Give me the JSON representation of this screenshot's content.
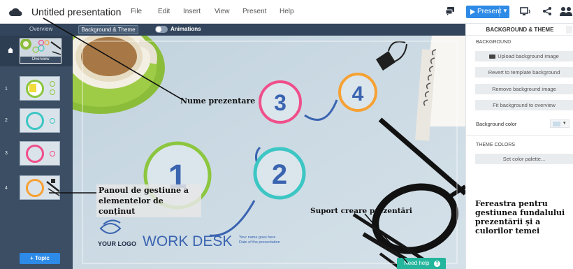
{
  "window": {
    "title": "Untitled presentation",
    "menu": [
      "File",
      "Edit",
      "Insert",
      "View",
      "Present",
      "Help"
    ],
    "present_label": "Present"
  },
  "subbar": {
    "overview": "Overview",
    "background_theme": "Background & Theme",
    "animations": "Animations"
  },
  "left_panel": {
    "overview_label": "Overview",
    "slides": [
      {
        "number": "1",
        "ring_color": "#8cc63f"
      },
      {
        "number": "2",
        "ring_color": "#3cc6c4"
      },
      {
        "number": "3",
        "ring_color": "#ef4f8a"
      },
      {
        "number": "4",
        "ring_color": "#f6a133"
      }
    ],
    "add_topic": "+ Topic"
  },
  "canvas": {
    "circles": [
      {
        "label": "1",
        "color": "#8cc63f"
      },
      {
        "label": "2",
        "color": "#3cc6c4"
      },
      {
        "label": "3",
        "color": "#ef4f8a"
      },
      {
        "label": "4",
        "color": "#f6a133"
      }
    ],
    "logo_text": "YOUR LOGO",
    "title": "WORK DESK",
    "subtitle_line1": "Your name goes here",
    "subtitle_line2": "Date of the presentation",
    "need_help": "Need help",
    "help_glyph": "?"
  },
  "right_panel": {
    "header": "BACKGROUND & THEME",
    "background_section": "BACKGROUND",
    "upload": "Upload background image",
    "revert": "Revert to template background",
    "remove": "Remove background image",
    "fit": "Fit background to overview",
    "background_color": "Background color",
    "theme_section": "THEME COLORS",
    "palette": "Set color palette..."
  },
  "annotations": {
    "name": "Nume prezentare",
    "panel_line1": "Panoul de gestiune a",
    "panel_line2": "elementelor de conținut",
    "support": "Suport creare prezentări",
    "window_text": "Fereastra pentru gestiunea fundalului prezentării și a culorilor temei"
  },
  "colors": {
    "accent_blue": "#2d8ae6",
    "dark_panel": "#33455c",
    "help_green": "#24b59d"
  }
}
